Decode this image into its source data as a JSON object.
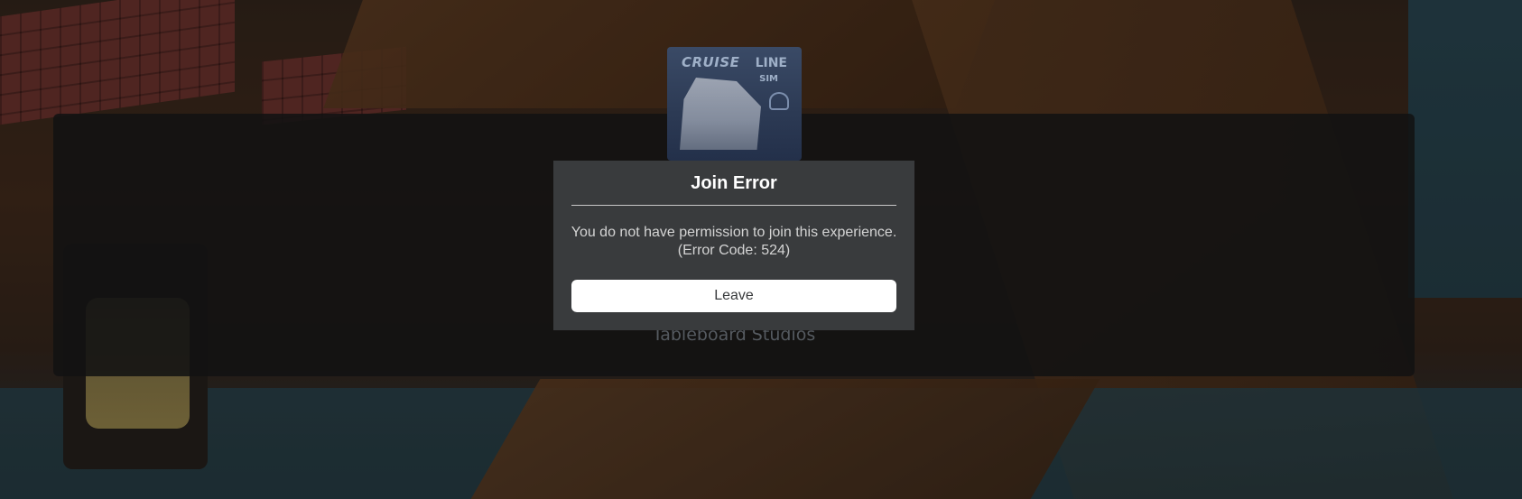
{
  "loading_screen": {
    "thumbnail": {
      "title_word1": "CRUISE",
      "title_word2": "LINE",
      "subtitle": "SIM"
    },
    "creator": "Tableboard Studios"
  },
  "error_dialog": {
    "title": "Join Error",
    "message_line1": "You do not have permission to join this experience.",
    "message_line2": "(Error Code: 524)",
    "leave_label": "Leave"
  },
  "colors": {
    "dialog_bg": "#393b3d",
    "button_bg": "#ffffff",
    "overlay_bg": "#121212"
  }
}
